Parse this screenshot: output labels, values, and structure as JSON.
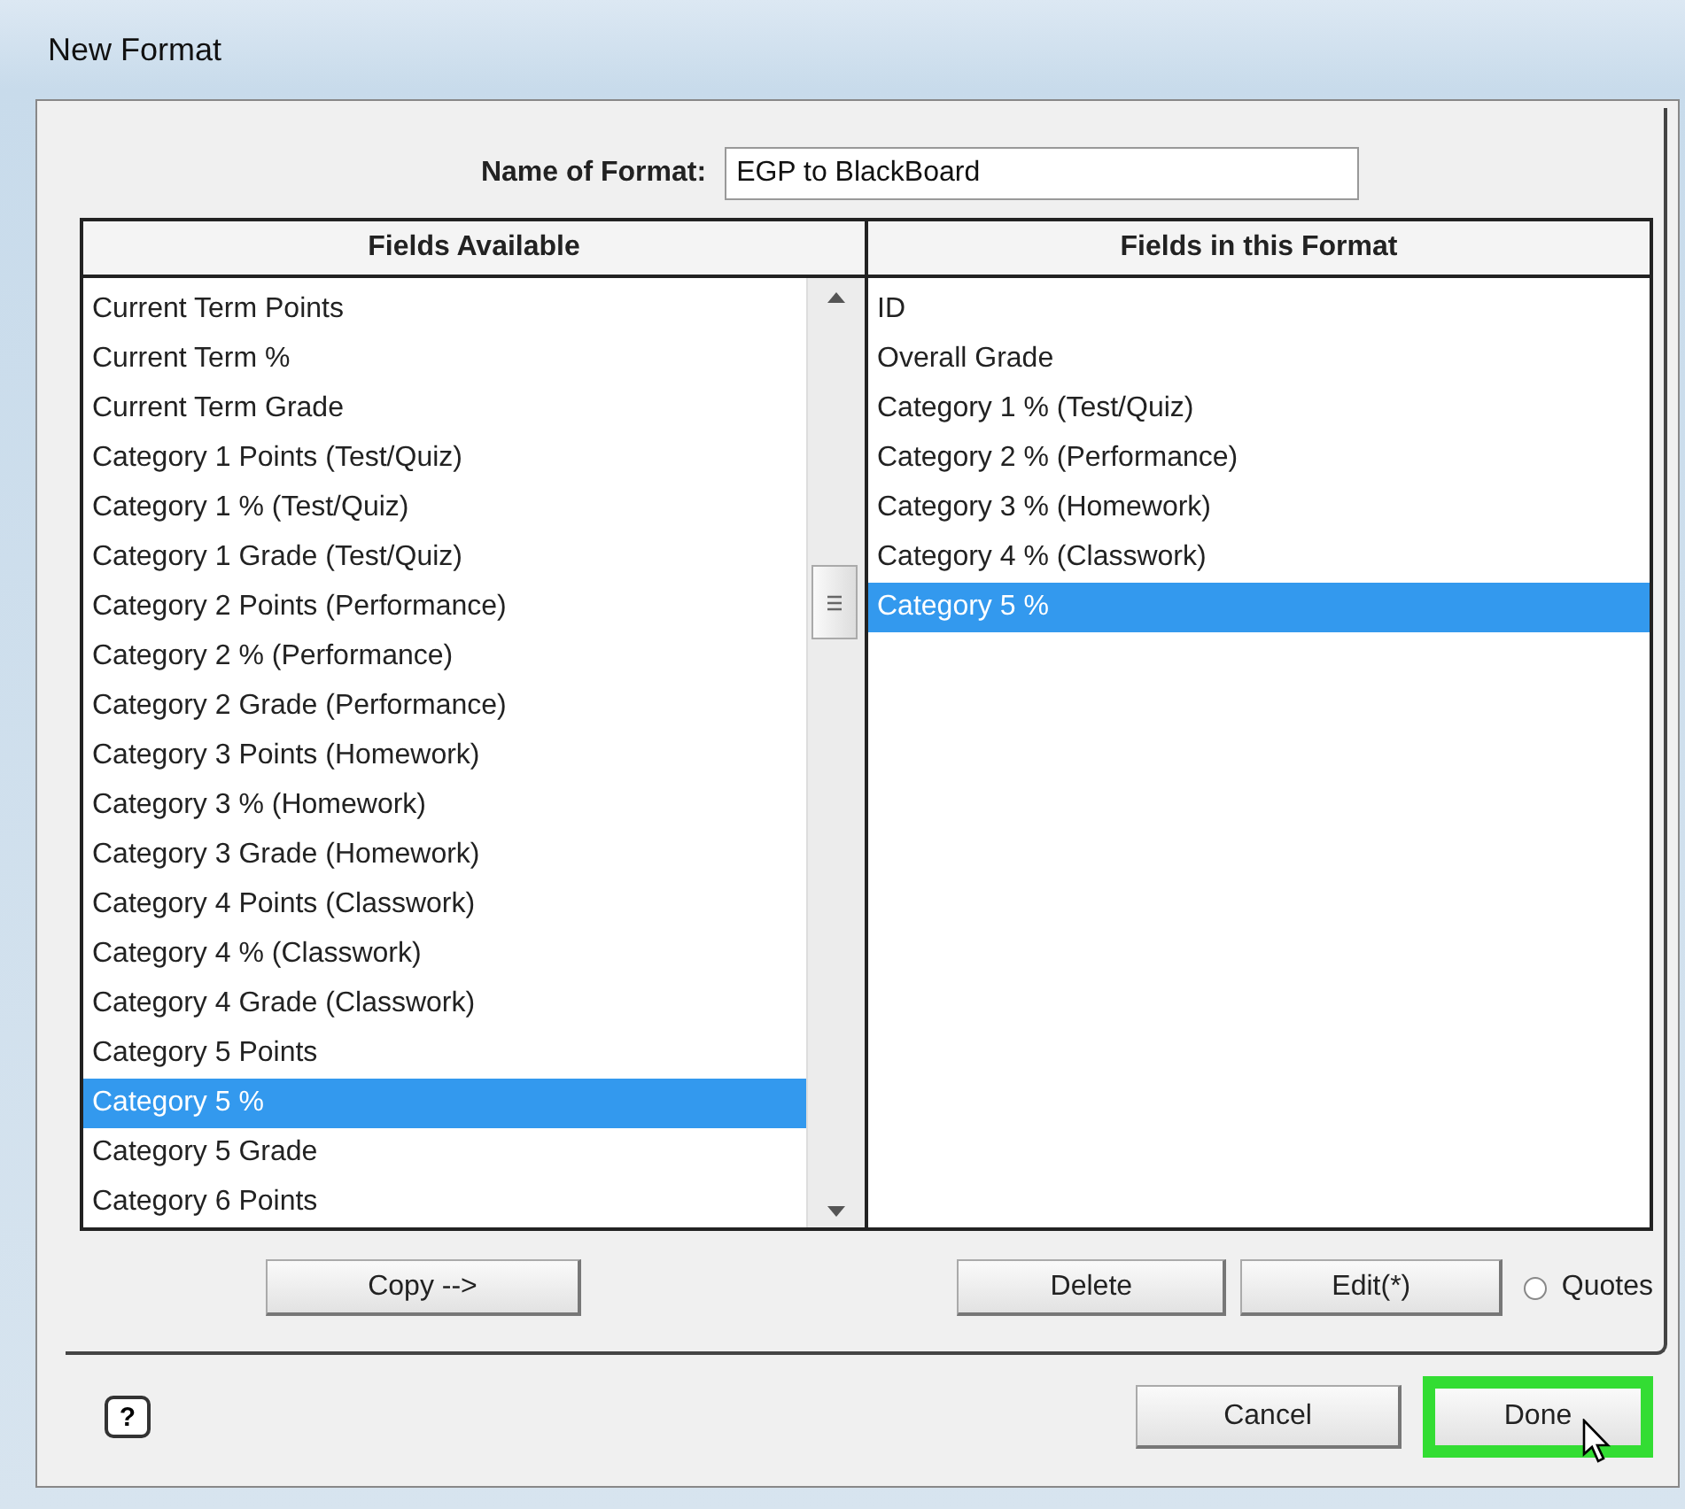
{
  "window": {
    "title": "New Format"
  },
  "name_of_format": {
    "label": "Name of Format:",
    "value": "EGP to BlackBoard"
  },
  "fields_available": {
    "heading": "Fields Available",
    "items": [
      {
        "label": "Current Term Points",
        "selected": false
      },
      {
        "label": "Current Term %",
        "selected": false
      },
      {
        "label": "Current Term Grade",
        "selected": false
      },
      {
        "label": "Category 1 Points (Test/Quiz)",
        "selected": false
      },
      {
        "label": "Category 1 % (Test/Quiz)",
        "selected": false
      },
      {
        "label": "Category 1 Grade (Test/Quiz)",
        "selected": false
      },
      {
        "label": "Category 2 Points (Performance)",
        "selected": false
      },
      {
        "label": "Category 2 % (Performance)",
        "selected": false
      },
      {
        "label": "Category 2 Grade (Performance)",
        "selected": false
      },
      {
        "label": "Category 3 Points (Homework)",
        "selected": false
      },
      {
        "label": "Category 3 % (Homework)",
        "selected": false
      },
      {
        "label": "Category 3 Grade (Homework)",
        "selected": false
      },
      {
        "label": "Category 4 Points (Classwork)",
        "selected": false
      },
      {
        "label": "Category 4 % (Classwork)",
        "selected": false
      },
      {
        "label": "Category 4 Grade (Classwork)",
        "selected": false
      },
      {
        "label": "Category 5 Points",
        "selected": false
      },
      {
        "label": "Category 5 %",
        "selected": true
      },
      {
        "label": "Category 5 Grade",
        "selected": false
      },
      {
        "label": "Category 6 Points",
        "selected": false
      }
    ]
  },
  "fields_in_format": {
    "heading": "Fields in this Format",
    "items": [
      {
        "label": "ID",
        "selected": false
      },
      {
        "label": "Overall Grade",
        "selected": false
      },
      {
        "label": "Category 1 % (Test/Quiz)",
        "selected": false
      },
      {
        "label": "Category 2 % (Performance)",
        "selected": false
      },
      {
        "label": "Category 3 % (Homework)",
        "selected": false
      },
      {
        "label": "Category 4 % (Classwork)",
        "selected": false
      },
      {
        "label": "Category 5 %",
        "selected": true
      }
    ]
  },
  "copy_button": "Copy -->",
  "delete_button": "Delete",
  "edit_button": "Edit(*)",
  "quotes": {
    "label": "Quotes",
    "checked": false
  },
  "help_button": "?",
  "cancel_button": "Cancel",
  "done_button": {
    "label": "Done",
    "highlighted": true
  }
}
